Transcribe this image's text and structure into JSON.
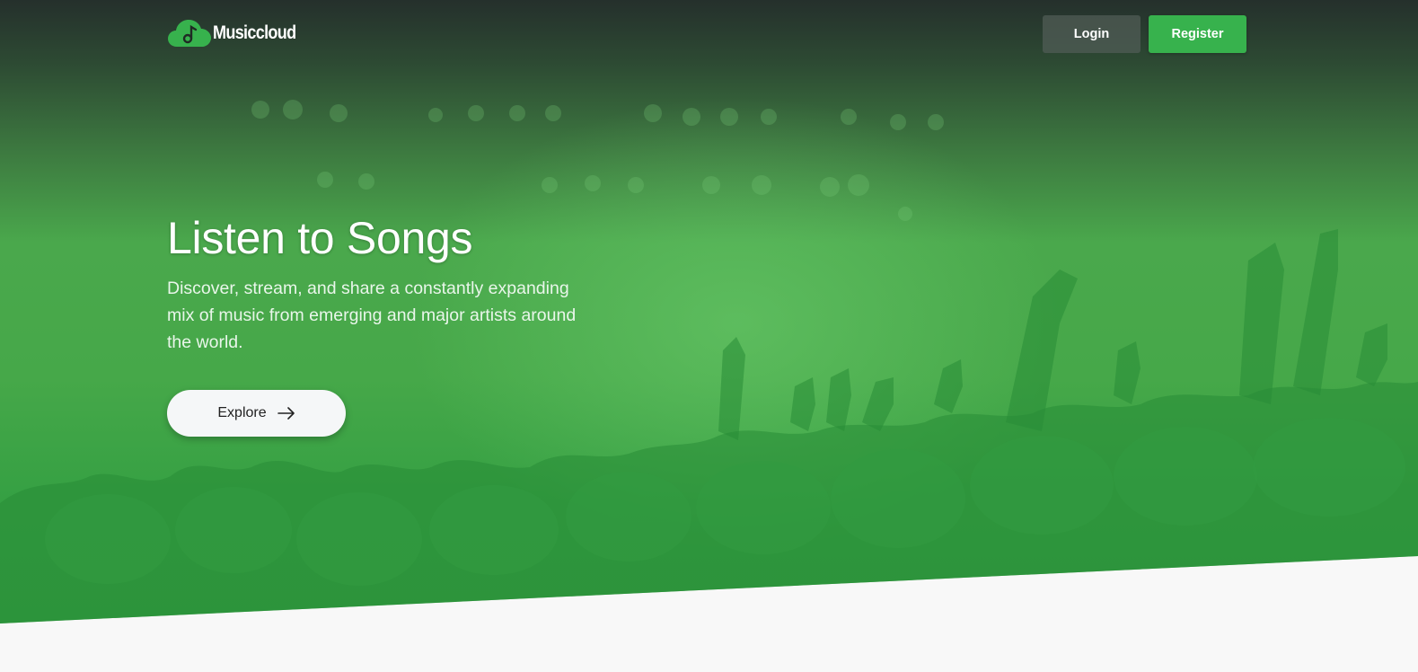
{
  "brand": {
    "name": "Musiccloud",
    "logo_icon": "cloud-music-note-icon",
    "color": "#37b24d"
  },
  "nav": {
    "login_label": "Login",
    "register_label": "Register"
  },
  "hero": {
    "title": "Listen to Songs",
    "subtitle": "Discover, stream, and share a constantly expanding mix of music from emerging and major artists around the world.",
    "cta_label": "Explore",
    "cta_icon": "arrow-right-icon"
  },
  "colors": {
    "accent": "#37b24d",
    "hero_green": "#3fa547",
    "header_dark": "#25302c",
    "page_bg": "#f8f8f8"
  }
}
